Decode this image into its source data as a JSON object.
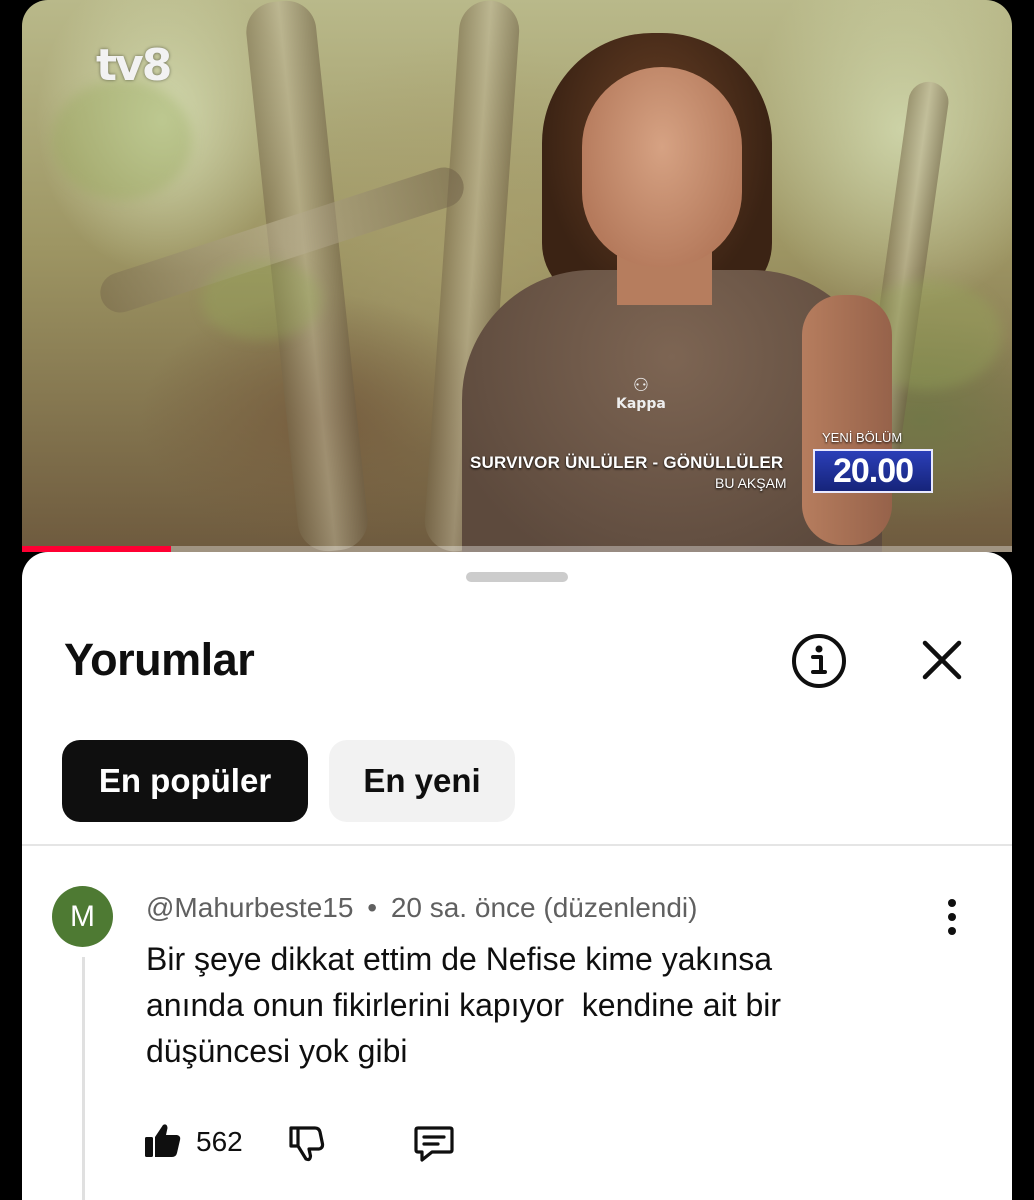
{
  "video": {
    "channel_logo": "tv8",
    "brand_logo": "Kappa",
    "promo": {
      "show_title": "SURVIVOR ÜNLÜLER - GÖNÜLLÜLER",
      "tonight": "BU AKŞAM",
      "new_episode": "YENİ BÖLÜM",
      "time": "20.00"
    },
    "progress_percent": 15
  },
  "comments_sheet": {
    "title": "Yorumlar",
    "info_icon": "info-icon",
    "close_icon": "close-icon",
    "sort_chips": [
      {
        "label": "En popüler",
        "selected": true
      },
      {
        "label": "En yeni",
        "selected": false
      }
    ]
  },
  "comment": {
    "avatar_letter": "M",
    "avatar_color": "#4e7a33",
    "author": "@Mahurbeste15",
    "separator": "•",
    "time": "20 sa. önce (düzenlendi)",
    "text_lines": [
      "Bir şeye dikkat ettim de Nefise kime yakınsa",
      "anında onun fikirlerini kapıyor  kendine ait bir",
      "düşüncesi yok gibi"
    ],
    "likes": "562",
    "icons": [
      "thumbs-up-icon",
      "thumbs-down-icon",
      "reply-icon",
      "more-vertical-icon"
    ]
  },
  "colors": {
    "accent_red": "#ff0033",
    "promo_blue": "#2b3fb8",
    "chip_active_bg": "#0f0f0f",
    "chip_inactive_bg": "#f2f2f2"
  }
}
